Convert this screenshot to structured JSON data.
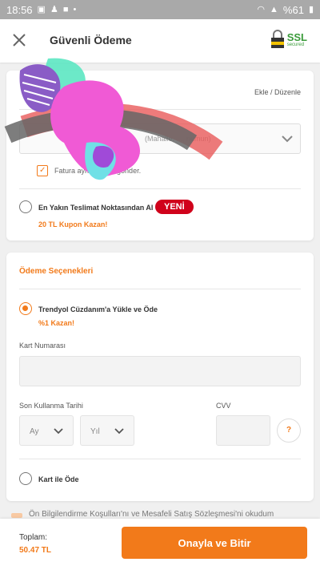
{
  "status_bar": {
    "time": "18:56",
    "battery": "%61"
  },
  "header": {
    "title": "Güvenli Ödeme",
    "ssl_big": "SSL",
    "ssl_small": "secured"
  },
  "address_card": {
    "edit_label": "Ekle / Düzenle",
    "select_placeholder": "(Mahalle, ..., numun)",
    "invoice_checkbox_label": "Fatura aynı adrese gönder.",
    "pickup_option": {
      "title": "En Yakın Teslimat Noktasından Al",
      "badge": "YENİ",
      "subtitle": "20 TL Kupon Kazan!"
    }
  },
  "payment_card": {
    "title": "Ödeme Seçenekleri",
    "wallet_option": {
      "title": "Trendyol Cüzdanım'a Yükle ve Öde",
      "subtitle": "%1 Kazan!"
    },
    "card_number_label": "Kart Numarası",
    "expiry_label": "Son Kullanma Tarihi",
    "month_placeholder": "Ay",
    "year_placeholder": "Yıl",
    "cvv_label": "CVV",
    "help_label": "?",
    "card_option": {
      "title": "Kart ile Öde"
    }
  },
  "agreement_text": "Ön Bilgilendirme Koşulları'nı ve Mesafeli Satış Sözleşmesi'ni okudum",
  "footer": {
    "total_label": "Toplam:",
    "total_value": "50.47 TL",
    "confirm_label": "Onayla ve Bitir"
  },
  "colors": {
    "accent": "#f27a1a",
    "badge_red": "#d0021b",
    "ssl_green": "#3a9b3a"
  }
}
